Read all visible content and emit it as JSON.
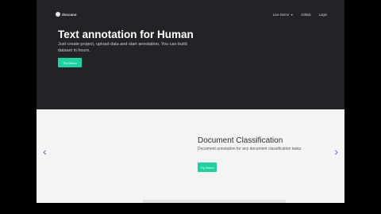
{
  "nav": {
    "brand": "doccano",
    "items": [
      "Live Demo",
      "Github",
      "Login"
    ]
  },
  "hero": {
    "title": "Text annotation for Human",
    "subtitle": "Just create project, upload data and start annotation. You can build dataset in hours.",
    "button": "Try Demo"
  },
  "carousel": {
    "title": "Document Classification",
    "subtitle": "Document annotation for any document classification tasks",
    "button": "Try Demo",
    "prev_icon": "chevron-left-icon",
    "next_icon": "chevron-right-icon"
  },
  "colors": {
    "accent": "#1fd1a1",
    "hero_bg": "#222326",
    "arrow": "#5a6ad0"
  }
}
